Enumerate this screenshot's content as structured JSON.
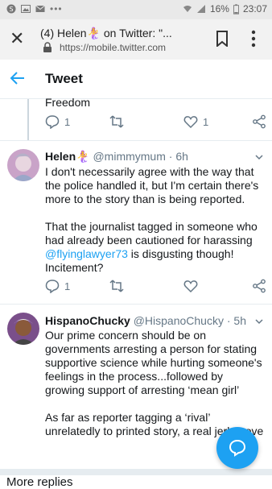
{
  "status_bar": {
    "battery": "16%",
    "time": "23:07"
  },
  "browser": {
    "tab_title": "(4) Helen🧜‍♀️ on Twitter: \"...",
    "url": "https://mobile.twitter.com"
  },
  "header": {
    "title": "Tweet"
  },
  "previous_tweet": {
    "snippet": "Freedom",
    "reply_count": "1",
    "like_count": "1"
  },
  "tweets": [
    {
      "name": "Helen🧜‍♀️",
      "handle": "@mimmymum",
      "time": "· 6h",
      "paragraph1": "I don't necessarily agree with the way that the police handled it, but I'm certain there's more to the story than is being reported.",
      "paragraph2_pre": "That the journalist tagged in someone who had already been cautioned for harassing ",
      "paragraph2_link": "@flyinglawyer73",
      "paragraph2_post": " is disgusting though! Incitement?",
      "reply_count": "1"
    },
    {
      "name": "HispanoChucky",
      "handle": "@HispanoChucky",
      "time": "· 5h",
      "paragraph1": "Our prime concern should be on governments arresting a person for stating supportive science while hurting someone's feelings in the process...followed by growing support of arresting ‘mean girl’",
      "paragraph2": "As far as reporter tagging a ‘rival’ unrelatedly to printed story, a real jerk move"
    }
  ],
  "footer": {
    "more_replies": "More replies"
  },
  "colors": {
    "accent": "#1da1f2",
    "secondary_text": "#657786"
  }
}
